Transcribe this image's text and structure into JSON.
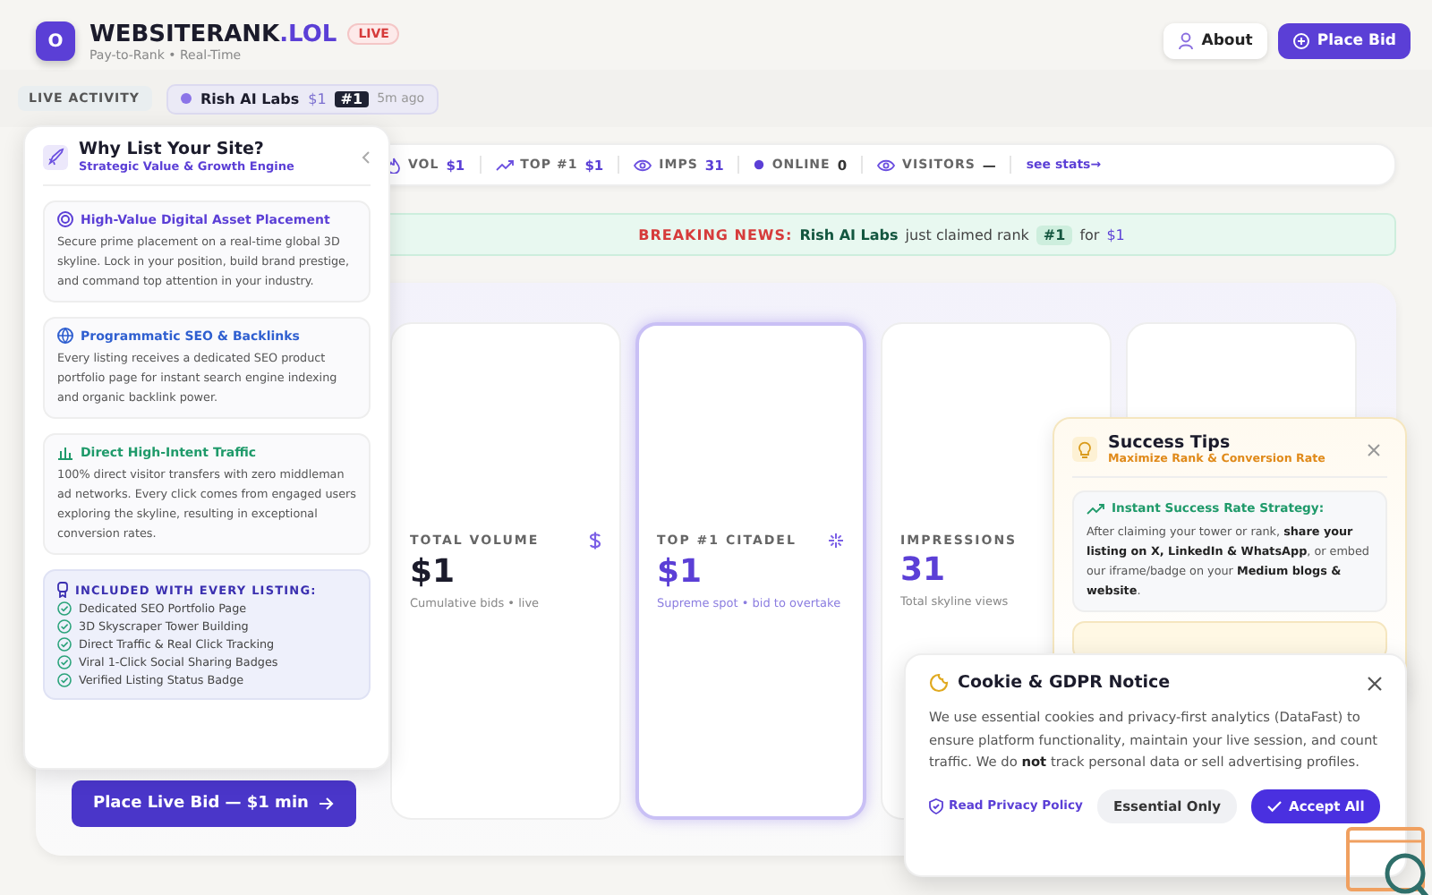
{
  "header": {
    "logo_letter": "O",
    "title": "WEBSITERANK",
    "title_suffix": ".LOL",
    "live_badge": "LIVE",
    "subtitle": "Pay-to-Rank • Real-Time",
    "buttons": [
      {
        "label": "About",
        "kind": "secondary"
      },
      {
        "label": "Place Bid",
        "kind": "primary"
      }
    ]
  },
  "activity": {
    "label": "LIVE ACTIVITY",
    "name": "Rish AI Labs",
    "amount": "$1",
    "rank": "#1",
    "time": "5m ago"
  },
  "stats": [
    {
      "label": "VOL",
      "value": "$1"
    },
    {
      "label": "TOP #1",
      "value": "$1"
    },
    {
      "label": "IMPS",
      "value": "31"
    },
    {
      "label": "ONLINE",
      "value": "0"
    },
    {
      "label": "VISITORS",
      "value": "—"
    }
  ],
  "stats_link": "see stats→",
  "news": {
    "label": "BREAKING NEWS:",
    "name": "Rish AI Labs",
    "middle": "just claimed rank",
    "rank": "#1",
    "tail": "for",
    "amount": "$1"
  },
  "cards": [
    {
      "kind": "stat",
      "label": "TOTAL VOLUME",
      "value": "$1",
      "caption": "Cumulative bids • live",
      "selected": false
    },
    {
      "kind": "stat",
      "label": "TOP #1 CITADEL",
      "value": "$1",
      "caption": "Supreme spot • bid to overtake",
      "selected": true
    },
    {
      "kind": "stat",
      "label": "IMPRESSIONS",
      "value": "31",
      "caption": "Total skyline views",
      "selected": false
    },
    {
      "kind": "blank",
      "selected": false
    }
  ],
  "bid_button": "Place Live Bid — $1 min",
  "why_panel": {
    "title": "Why List Your Site?",
    "subtitle": "Strategic Value & Growth Engine",
    "sections": [
      {
        "color": "#5b3fd6",
        "title": "High-Value Digital Asset Placement",
        "text": "Secure prime placement on a real-time global 3D skyline. Lock in your position, build brand prestige, and command top attention in your industry."
      },
      {
        "color": "#2f5fd0",
        "title": "Programmatic SEO & Backlinks",
        "text": "Every listing receives a dedicated SEO product portfolio page for instant search engine indexing and organic backlink power."
      },
      {
        "color": "#1f9a6a",
        "title": "Direct High-Intent Traffic",
        "text": "100% direct visitor transfers with zero middleman ad networks. Every click comes from engaged users exploring the skyline, resulting in exceptional conversion rates."
      }
    ],
    "included_title": "INCLUDED WITH EVERY LISTING:",
    "included": [
      "Dedicated SEO Portfolio Page",
      "3D Skyscraper Tower Building",
      "Direct Traffic & Real Click Tracking",
      "Viral 1-Click Social Sharing Badges",
      "Verified Listing Status Badge"
    ]
  },
  "tips": {
    "title": "Success Tips",
    "subtitle": "Maximize Rank & Conversion Rate",
    "strategy_title": "Instant Success Rate Strategy:",
    "strategy_text": "After claiming your tower or rank, **share your listing on X, LinkedIn & WhatsApp**, or embed our iframe/badge on your **Medium blogs & website**."
  },
  "cookie": {
    "title": "Cookie & GDPR Notice",
    "text": "We use essential cookies and privacy-first analytics (DataFast) to ensure platform functionality, maintain your live session, and count traffic. We do **not** track personal data or sell advertising profiles.",
    "link": "Read Privacy Policy",
    "buttons": [
      {
        "label": "Essential Only",
        "kind": "secondary"
      },
      {
        "label": "Accept All",
        "kind": "primary"
      }
    ]
  }
}
